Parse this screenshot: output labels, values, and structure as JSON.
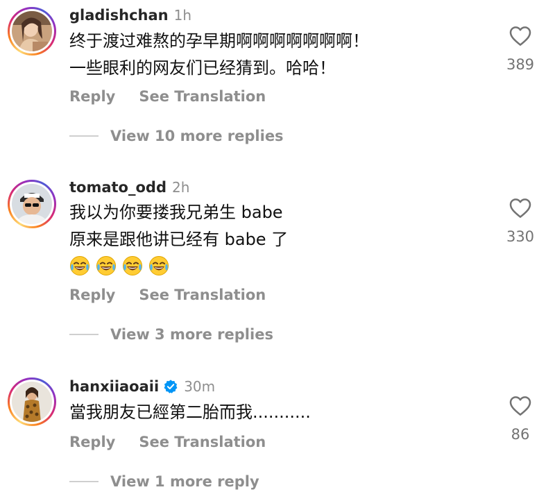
{
  "comments": [
    {
      "username": "gladishchan",
      "time": "1h",
      "verified": false,
      "lines": [
        "终于渡过难熬的孕早期啊啊啊啊啊啊啊！",
        "一些眼利的网友们已经猜到。哈哈！"
      ],
      "emoji": [],
      "likes": "389",
      "reply_label": "Reply",
      "translate_label": "See Translation",
      "view_replies": "View 10 more replies"
    },
    {
      "username": "tomato_odd",
      "time": "2h",
      "verified": false,
      "lines": [
        "我以为你要搂我兄弟生 babe",
        "原来是跟他讲已经有 babe 了"
      ],
      "emoji": [
        "face-with-tears-of-joy",
        "face-with-tears-of-joy",
        "face-with-tears-of-joy",
        "face-with-tears-of-joy"
      ],
      "likes": "330",
      "reply_label": "Reply",
      "translate_label": "See Translation",
      "view_replies": "View 3 more replies"
    },
    {
      "username": "hanxiiaoaii",
      "time": "30m",
      "verified": true,
      "lines": [
        "當我朋友已經第二胎而我..........."
      ],
      "emoji": [],
      "likes": "86",
      "reply_label": "Reply",
      "translate_label": "See Translation",
      "view_replies": "View 1 more reply"
    }
  ],
  "icons": {
    "like": "heart-outline-icon",
    "verified": "verified-badge-icon",
    "emoji": "face-with-tears-of-joy"
  },
  "colors": {
    "secondary_text": "#8e8e8e",
    "verified_blue": "#0095f6"
  }
}
